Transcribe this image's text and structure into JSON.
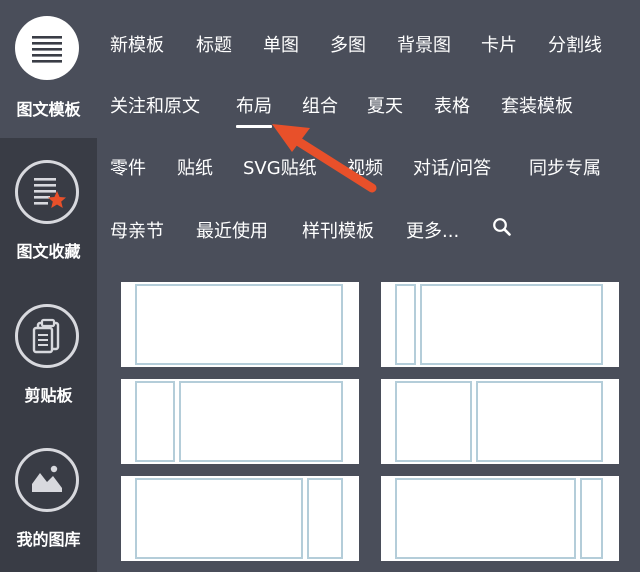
{
  "sidebar": {
    "items": [
      {
        "label": "图文模板",
        "icon": "list-icon",
        "active": true
      },
      {
        "label": "图文收藏",
        "icon": "star-document-icon"
      },
      {
        "label": "剪贴板",
        "icon": "clipboard-icon"
      },
      {
        "label": "我的图库",
        "icon": "image-gallery-icon"
      }
    ]
  },
  "categories": {
    "row1": [
      "新模板",
      "标题",
      "单图",
      "多图",
      "背景图",
      "卡片",
      "分割线"
    ],
    "row2": [
      "关注和原文",
      "布局",
      "组合",
      "夏天",
      "表格",
      "套装模板"
    ],
    "row3": [
      "零件",
      "贴纸",
      "SVG贴纸",
      "视频",
      "对话/问答",
      "同步专属"
    ],
    "row4": [
      "母亲节",
      "最近使用",
      "样刊模板",
      "更多..."
    ],
    "active": "布局"
  },
  "colors": {
    "sidebar_bg": "#393c45",
    "main_bg": "#4a4e5a",
    "tile_border": "#b4cdd9",
    "annotation_arrow": "#e8502a",
    "badge_star": "#e8502a"
  }
}
